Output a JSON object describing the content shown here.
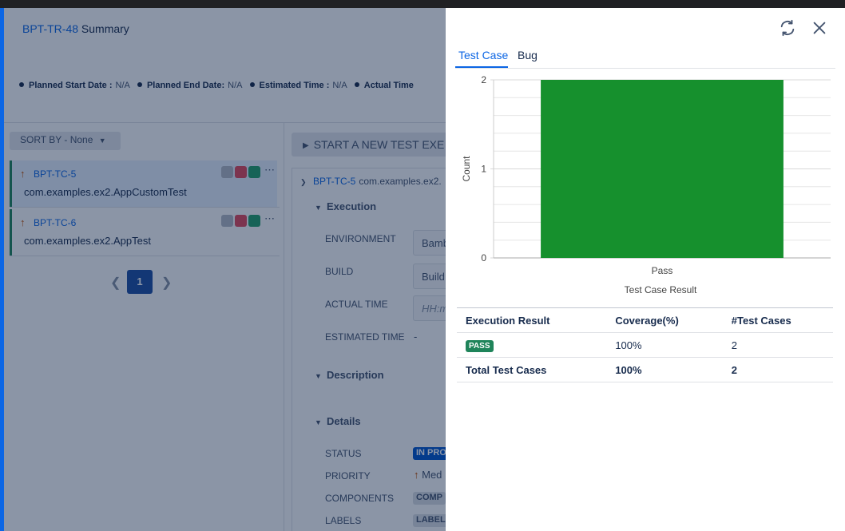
{
  "summary": {
    "key": "BPT-TR-48",
    "title": "Summary",
    "dates": [
      {
        "label": "Planned Start Date :",
        "value": "N/A"
      },
      {
        "label": "Planned End Date:",
        "value": "N/A"
      },
      {
        "label": "Estimated Time :",
        "value": "N/A"
      },
      {
        "label": "Actual Time",
        "value": ""
      }
    ]
  },
  "sort": {
    "label": "SORT BY - None"
  },
  "test_cases": [
    {
      "key": "BPT-TC-5",
      "class": "com.examples.ex2.AppCustomTest",
      "selected": true
    },
    {
      "key": "BPT-TC-6",
      "class": "com.examples.ex2.AppTest",
      "selected": false
    }
  ],
  "status_colors": [
    "#b3b9c4",
    "#e2485c",
    "#22a06b"
  ],
  "more_icon": "more-icon",
  "pager": {
    "current": "1"
  },
  "execution_panel": {
    "start_button": "START A NEW TEST EXE",
    "tc_key": "BPT-TC-5",
    "tc_name": "com.examples.ex2.",
    "execution_title": "Execution",
    "fields": [
      {
        "label": "ENVIRONMENT",
        "value": "Bamb"
      },
      {
        "label": "BUILD",
        "value": "Build"
      },
      {
        "label": "ACTUAL TIME",
        "placeholder": "HH:m"
      },
      {
        "label": "ESTIMATED TIME",
        "value": "-"
      }
    ],
    "description_title": "Description",
    "details_title": "Details",
    "details": [
      {
        "label": "STATUS",
        "value": "IN PRO"
      },
      {
        "label": "PRIORITY",
        "value": "Med"
      },
      {
        "label": "COMPONENTS",
        "value": "COMP"
      },
      {
        "label": "LABELS",
        "value": "LABEL"
      }
    ]
  },
  "drawer": {
    "refresh_icon": "refresh-icon",
    "close_icon": "close-icon",
    "tabs": [
      {
        "label": "Test Case",
        "active": true
      },
      {
        "label": "Bug",
        "active": false
      }
    ],
    "table": {
      "headers": [
        "Execution Result",
        "Coverage(%)",
        "#Test Cases"
      ],
      "rows": [
        {
          "result": "PASS",
          "coverage": "100%",
          "count": "2"
        }
      ],
      "total": {
        "label": "Total Test Cases",
        "coverage": "100%",
        "count": "2"
      }
    }
  },
  "chart_data": {
    "type": "bar",
    "categories": [
      "Pass"
    ],
    "values": [
      2
    ],
    "title": "",
    "xlabel": "Test Case Result",
    "ylabel": "Count",
    "ylim": [
      0,
      2
    ],
    "yticks": [
      0,
      1,
      2
    ],
    "bar_color": "#16902d",
    "grid": true
  }
}
